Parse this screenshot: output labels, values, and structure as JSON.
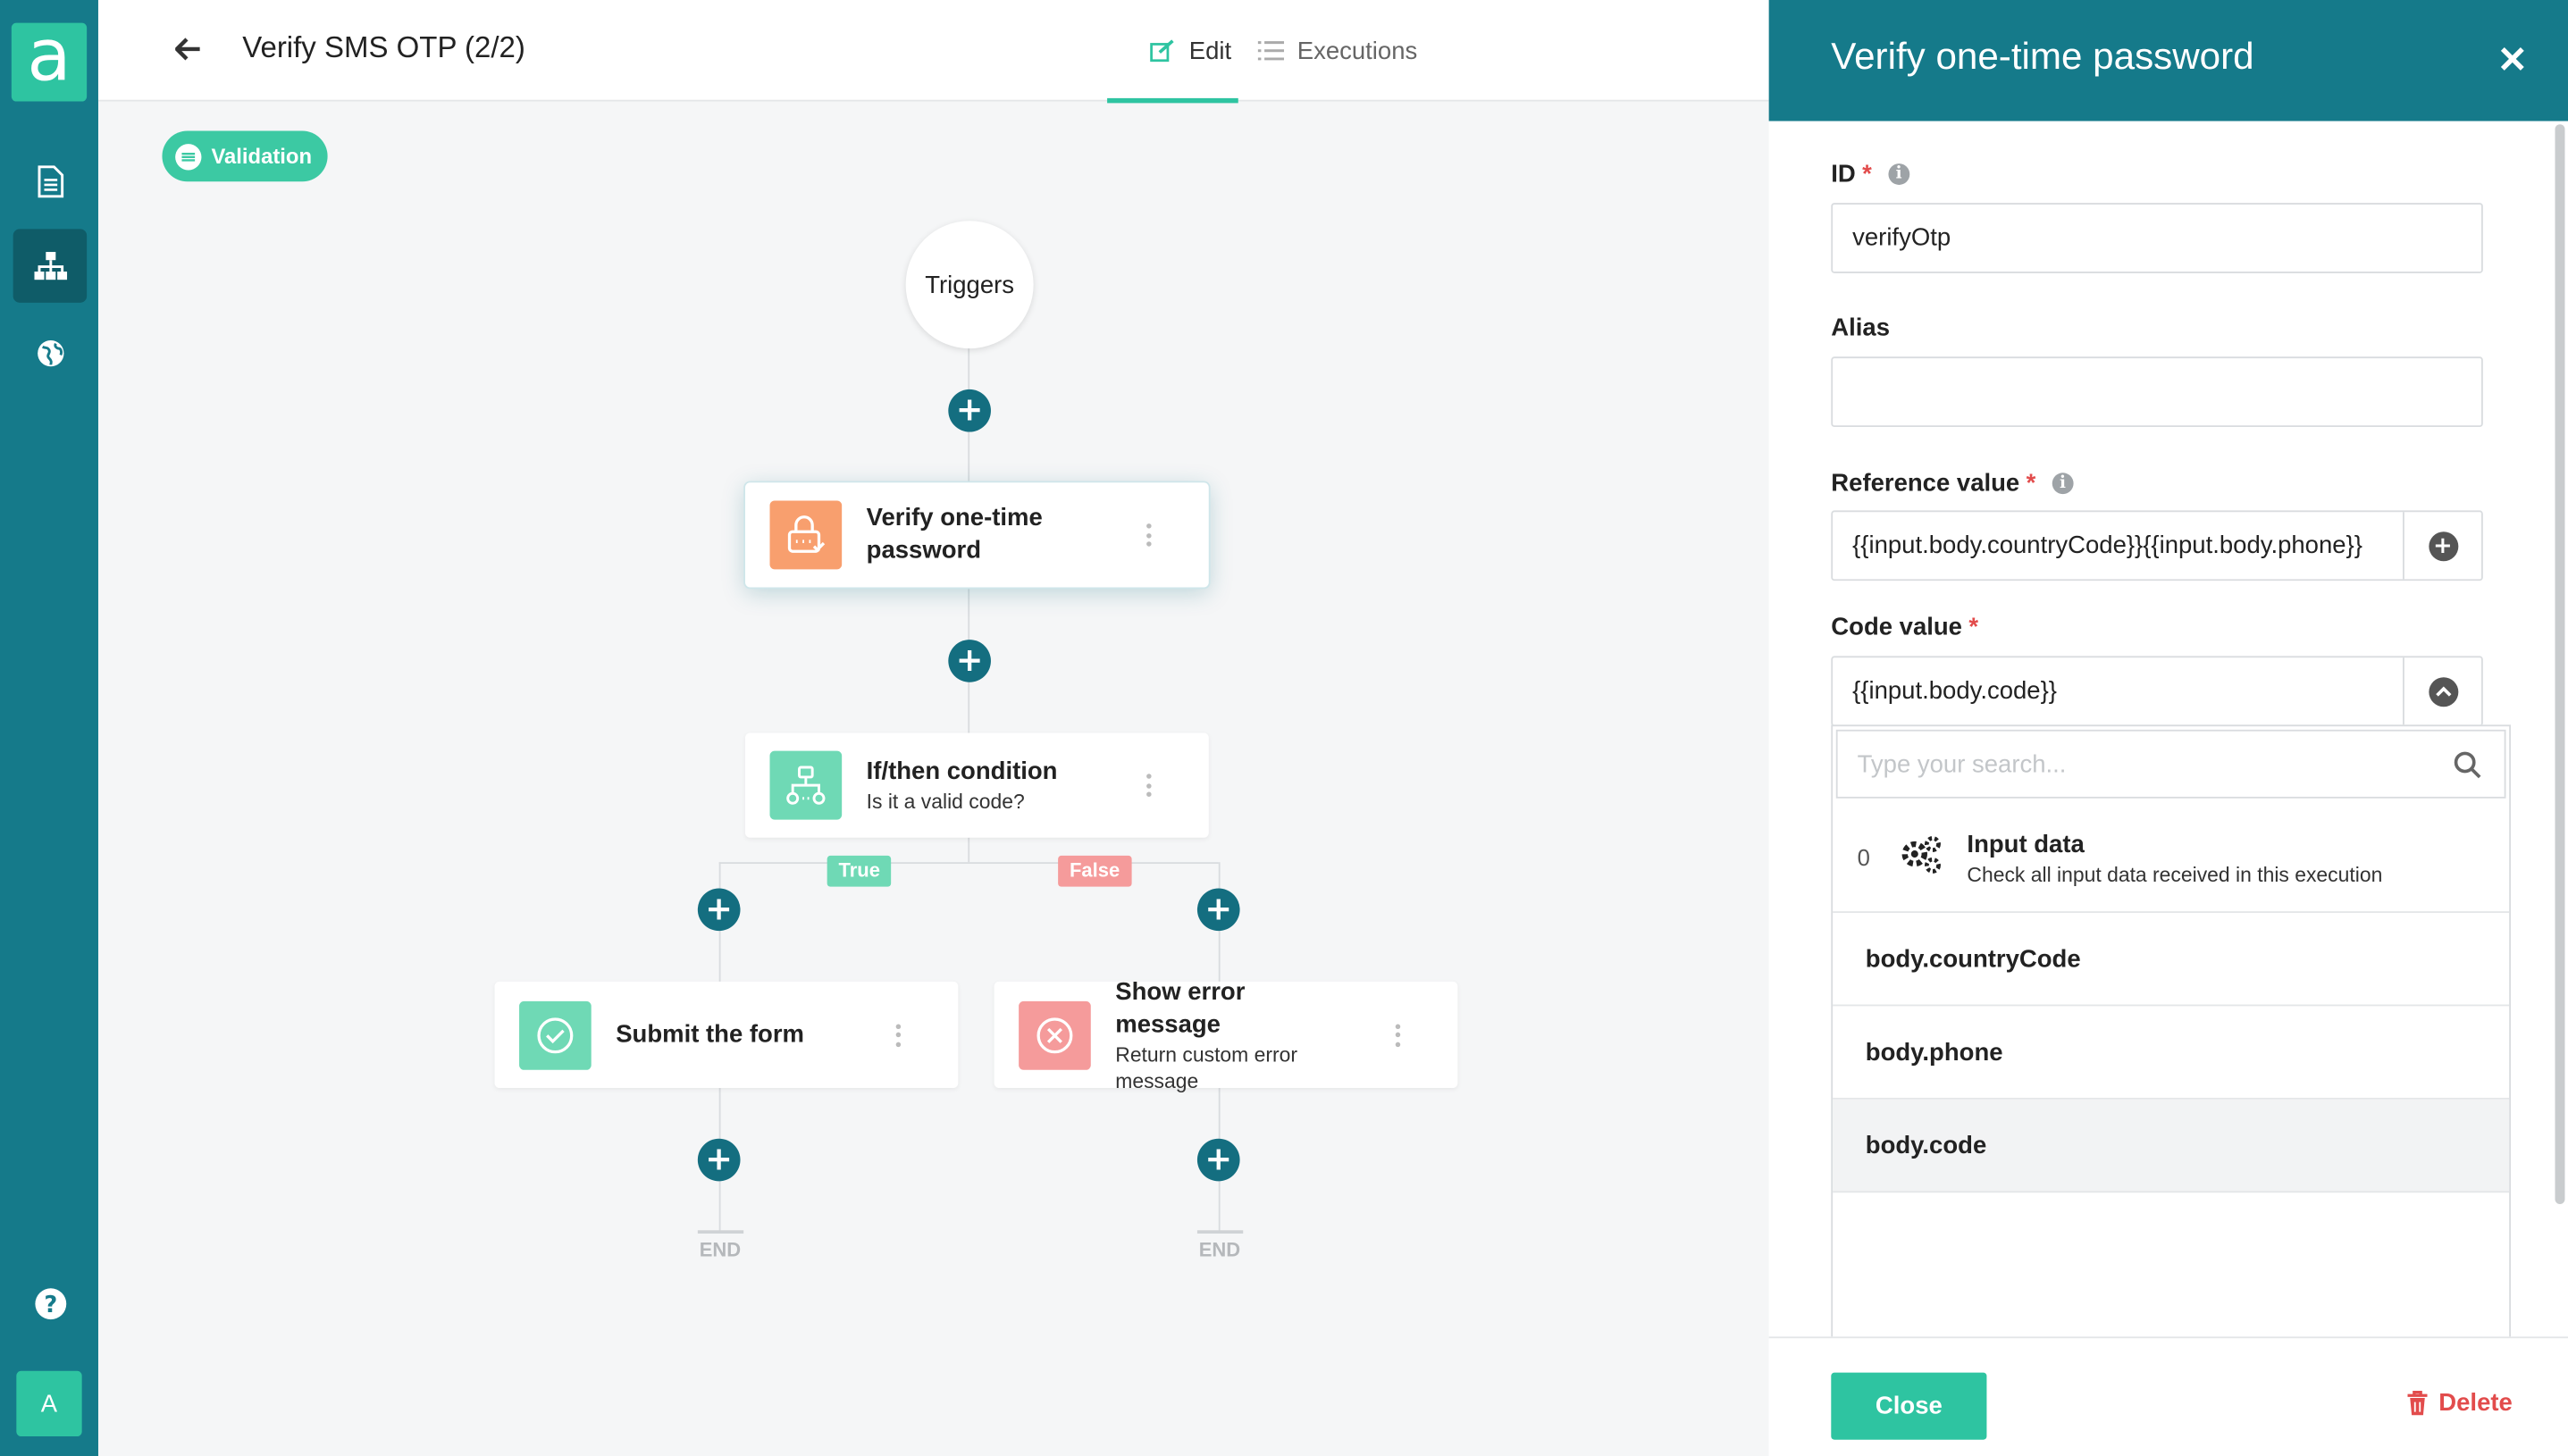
{
  "app": {
    "logo_letter": "a",
    "user_initial": "A"
  },
  "header": {
    "title": "Verify SMS OTP (2/2)",
    "tabs": [
      {
        "label": "Edit",
        "active": true
      },
      {
        "label": "Executions",
        "active": false
      }
    ]
  },
  "canvas": {
    "badge": "Validation",
    "triggers_label": "Triggers",
    "nodes": {
      "verify": {
        "title": "Verify one-time password"
      },
      "condition": {
        "title": "If/then condition",
        "subtitle": "Is it a valid code?"
      },
      "submit": {
        "title": "Submit the form"
      },
      "error": {
        "title": "Show error message",
        "subtitle": "Return custom error message"
      }
    },
    "branches": {
      "true_label": "True",
      "false_label": "False"
    },
    "end_label": "END"
  },
  "panel": {
    "title": "Verify one-time password",
    "fields": {
      "id": {
        "label": "ID",
        "value": "verifyOtp"
      },
      "alias": {
        "label": "Alias",
        "value": ""
      },
      "reference": {
        "label": "Reference value",
        "value": "{{input.body.countryCode}}{{input.body.phone}}"
      },
      "code": {
        "label": "Code value",
        "value": "{{input.body.code}}"
      }
    },
    "dropdown": {
      "search_placeholder": "Type your search...",
      "input_data": {
        "count": "0",
        "title": "Input data",
        "subtitle": "Check all input data received in this execution"
      },
      "options": [
        "body.countryCode",
        "body.phone",
        "body.code"
      ],
      "highlighted": "body.code"
    },
    "footer": {
      "close_label": "Close",
      "delete_label": "Delete"
    }
  },
  "colors": {
    "primary": "#157a8a",
    "accent": "#2ec4a1",
    "danger": "#e24c4c",
    "verify_icon": "#f89f6e",
    "condition_icon": "#6fd9b5",
    "error_icon": "#f59b9b",
    "true_label": "#6fd9b5",
    "false_label": "#f59b9b"
  }
}
